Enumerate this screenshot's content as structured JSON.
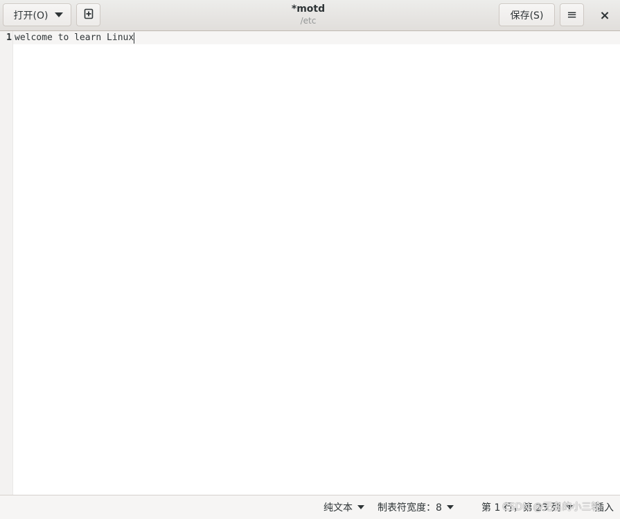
{
  "header": {
    "open_label": "打开(O)",
    "title": "*motd",
    "subtitle": "/etc",
    "save_label": "保存(S)",
    "close_glyph": "×",
    "menu_glyph": "≡"
  },
  "editor": {
    "line_numbers": [
      "1"
    ],
    "lines": [
      "welcome to learn Linux"
    ],
    "cursor_line": 1,
    "cursor_column": 23
  },
  "statusbar": {
    "language": "纯文本",
    "tab_width": "制表符宽度：8",
    "position": "第 1 行，第 23 列",
    "mode": "插入"
  },
  "watermark": "CSDN @无名的小三轮",
  "colors": {
    "header_bg": "#e1dedb",
    "gutter_bg": "#f3f2f1",
    "text": "#2e3436"
  }
}
